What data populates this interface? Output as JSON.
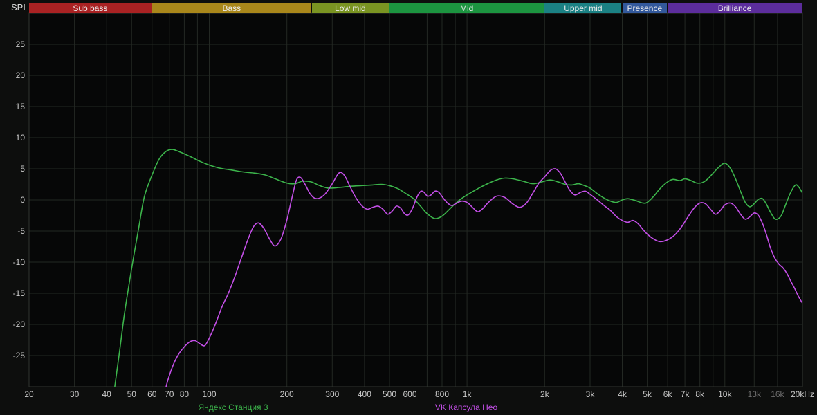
{
  "chart_data": {
    "type": "line",
    "title": "",
    "x_axis": {
      "scale": "log",
      "min": 20,
      "max": 20000,
      "unit": "Hz"
    },
    "y_axis": {
      "label": "SPL",
      "min": -30,
      "max": 30,
      "tick_step": 5
    },
    "y_ticks": [
      25,
      20,
      15,
      10,
      5,
      0,
      -5,
      -10,
      -15,
      -20,
      -25
    ],
    "x_ticks": [
      {
        "f": 20,
        "label": "20"
      },
      {
        "f": 30,
        "label": "30"
      },
      {
        "f": 40,
        "label": "40"
      },
      {
        "f": 50,
        "label": "50"
      },
      {
        "f": 60,
        "label": "60"
      },
      {
        "f": 70,
        "label": "70"
      },
      {
        "f": 80,
        "label": "80"
      },
      {
        "f": 100,
        "label": "100"
      },
      {
        "f": 200,
        "label": "200"
      },
      {
        "f": 300,
        "label": "300"
      },
      {
        "f": 400,
        "label": "400"
      },
      {
        "f": 500,
        "label": "500"
      },
      {
        "f": 600,
        "label": "600"
      },
      {
        "f": 800,
        "label": "800"
      },
      {
        "f": 1000,
        "label": "1k"
      },
      {
        "f": 2000,
        "label": "2k"
      },
      {
        "f": 3000,
        "label": "3k"
      },
      {
        "f": 4000,
        "label": "4k"
      },
      {
        "f": 5000,
        "label": "5k"
      },
      {
        "f": 6000,
        "label": "6k"
      },
      {
        "f": 7000,
        "label": "7k"
      },
      {
        "f": 8000,
        "label": "8k"
      },
      {
        "f": 10000,
        "label": "10k"
      },
      {
        "f": 13000,
        "label": "13k",
        "muted": true
      },
      {
        "f": 16000,
        "label": "16k",
        "muted": true
      },
      {
        "f": 20000,
        "label": "20kHz"
      }
    ],
    "grid_frequencies": [
      20,
      30,
      40,
      50,
      60,
      70,
      80,
      90,
      100,
      200,
      300,
      400,
      500,
      600,
      700,
      800,
      900,
      1000,
      2000,
      3000,
      4000,
      5000,
      6000,
      7000,
      8000,
      9000,
      10000,
      13000,
      16000,
      20000
    ],
    "bands": [
      {
        "label": "Sub bass",
        "from": 20,
        "to": 60,
        "color": "#a92223"
      },
      {
        "label": "Bass",
        "from": 60,
        "to": 250,
        "color": "#a9871b"
      },
      {
        "label": "Low mid",
        "from": 250,
        "to": 500,
        "color": "#7a9422"
      },
      {
        "label": "Mid",
        "from": 500,
        "to": 2000,
        "color": "#1c9440"
      },
      {
        "label": "Upper mid",
        "from": 2000,
        "to": 4000,
        "color": "#1b8184"
      },
      {
        "label": "Presence",
        "from": 4000,
        "to": 6000,
        "color": "#33599c"
      },
      {
        "label": "Brilliance",
        "from": 6000,
        "to": 20000,
        "color": "#5c2d9c"
      }
    ],
    "series": [
      {
        "name": "Яндекс Станция 3",
        "color": "#3cb44b",
        "points": [
          [
            43,
            -30
          ],
          [
            45,
            -24
          ],
          [
            47,
            -18
          ],
          [
            50,
            -11
          ],
          [
            53,
            -5
          ],
          [
            56,
            0.5
          ],
          [
            60,
            4
          ],
          [
            64,
            6.6
          ],
          [
            68,
            7.8
          ],
          [
            72,
            8.1
          ],
          [
            78,
            7.6
          ],
          [
            85,
            6.9
          ],
          [
            92,
            6.2
          ],
          [
            100,
            5.6
          ],
          [
            110,
            5.1
          ],
          [
            122,
            4.8
          ],
          [
            135,
            4.5
          ],
          [
            150,
            4.3
          ],
          [
            165,
            4.0
          ],
          [
            180,
            3.4
          ],
          [
            200,
            2.7
          ],
          [
            215,
            2.6
          ],
          [
            230,
            3.0
          ],
          [
            248,
            2.9
          ],
          [
            268,
            2.3
          ],
          [
            290,
            1.9
          ],
          [
            320,
            2.0
          ],
          [
            355,
            2.2
          ],
          [
            390,
            2.3
          ],
          [
            430,
            2.4
          ],
          [
            465,
            2.5
          ],
          [
            500,
            2.3
          ],
          [
            540,
            1.8
          ],
          [
            580,
            1.0
          ],
          [
            620,
            0.2
          ],
          [
            660,
            -1.0
          ],
          [
            700,
            -2.2
          ],
          [
            750,
            -3.0
          ],
          [
            800,
            -2.6
          ],
          [
            850,
            -1.6
          ],
          [
            900,
            -0.6
          ],
          [
            950,
            0.2
          ],
          [
            1000,
            0.8
          ],
          [
            1100,
            1.8
          ],
          [
            1200,
            2.6
          ],
          [
            1300,
            3.2
          ],
          [
            1400,
            3.5
          ],
          [
            1500,
            3.4
          ],
          [
            1650,
            3.0
          ],
          [
            1800,
            2.6
          ],
          [
            1950,
            2.9
          ],
          [
            2100,
            3.2
          ],
          [
            2250,
            2.9
          ],
          [
            2400,
            2.5
          ],
          [
            2550,
            2.4
          ],
          [
            2700,
            2.6
          ],
          [
            2850,
            2.3
          ],
          [
            3000,
            1.9
          ],
          [
            3200,
            1.0
          ],
          [
            3400,
            0.3
          ],
          [
            3600,
            -0.2
          ],
          [
            3800,
            -0.4
          ],
          [
            4000,
            0.0
          ],
          [
            4200,
            0.2
          ],
          [
            4500,
            -0.1
          ],
          [
            4800,
            -0.5
          ],
          [
            5000,
            -0.4
          ],
          [
            5300,
            0.6
          ],
          [
            5600,
            1.8
          ],
          [
            6000,
            2.9
          ],
          [
            6300,
            3.3
          ],
          [
            6700,
            3.1
          ],
          [
            7000,
            3.4
          ],
          [
            7400,
            3.1
          ],
          [
            7800,
            2.7
          ],
          [
            8200,
            2.8
          ],
          [
            8600,
            3.4
          ],
          [
            9000,
            4.3
          ],
          [
            9500,
            5.3
          ],
          [
            10000,
            5.9
          ],
          [
            10500,
            5.1
          ],
          [
            11000,
            3.4
          ],
          [
            11500,
            1.4
          ],
          [
            12000,
            -0.4
          ],
          [
            12500,
            -1.1
          ],
          [
            13000,
            -0.6
          ],
          [
            13500,
            0.1
          ],
          [
            14000,
            0.2
          ],
          [
            14500,
            -0.7
          ],
          [
            15000,
            -1.9
          ],
          [
            15700,
            -3.1
          ],
          [
            16500,
            -2.6
          ],
          [
            17200,
            -0.8
          ],
          [
            18000,
            1.2
          ],
          [
            18800,
            2.4
          ],
          [
            19400,
            2.0
          ],
          [
            20000,
            1.1
          ]
        ]
      },
      {
        "name": "VK Капсула Нео",
        "color": "#c44fe8",
        "points": [
          [
            68,
            -30
          ],
          [
            70,
            -28.2
          ],
          [
            73,
            -26.2
          ],
          [
            76,
            -24.8
          ],
          [
            80,
            -23.6
          ],
          [
            84,
            -22.8
          ],
          [
            88,
            -22.6
          ],
          [
            92,
            -23.1
          ],
          [
            96,
            -23.4
          ],
          [
            100,
            -22.2
          ],
          [
            106,
            -19.8
          ],
          [
            112,
            -17.2
          ],
          [
            118,
            -15.2
          ],
          [
            125,
            -12.6
          ],
          [
            132,
            -9.8
          ],
          [
            140,
            -6.8
          ],
          [
            148,
            -4.4
          ],
          [
            155,
            -3.7
          ],
          [
            163,
            -4.6
          ],
          [
            172,
            -6.4
          ],
          [
            180,
            -7.4
          ],
          [
            190,
            -6.2
          ],
          [
            200,
            -3.2
          ],
          [
            210,
            0.6
          ],
          [
            218,
            3.2
          ],
          [
            226,
            3.6
          ],
          [
            236,
            2.4
          ],
          [
            246,
            1.0
          ],
          [
            256,
            0.3
          ],
          [
            268,
            0.3
          ],
          [
            282,
            1.0
          ],
          [
            300,
            2.6
          ],
          [
            315,
            4.1
          ],
          [
            325,
            4.4
          ],
          [
            337,
            3.7
          ],
          [
            352,
            2.1
          ],
          [
            370,
            0.4
          ],
          [
            390,
            -0.9
          ],
          [
            410,
            -1.5
          ],
          [
            430,
            -1.2
          ],
          [
            452,
            -1.0
          ],
          [
            472,
            -1.5
          ],
          [
            492,
            -2.3
          ],
          [
            512,
            -1.8
          ],
          [
            532,
            -1.0
          ],
          [
            552,
            -1.3
          ],
          [
            572,
            -2.2
          ],
          [
            592,
            -2.4
          ],
          [
            615,
            -1.3
          ],
          [
            640,
            0.5
          ],
          [
            662,
            1.4
          ],
          [
            682,
            1.2
          ],
          [
            702,
            0.6
          ],
          [
            725,
            0.8
          ],
          [
            750,
            1.4
          ],
          [
            778,
            1.2
          ],
          [
            808,
            0.3
          ],
          [
            840,
            -0.5
          ],
          [
            872,
            -0.9
          ],
          [
            905,
            -0.6
          ],
          [
            950,
            -0.2
          ],
          [
            1000,
            -0.4
          ],
          [
            1050,
            -1.2
          ],
          [
            1100,
            -1.9
          ],
          [
            1150,
            -1.4
          ],
          [
            1210,
            -0.4
          ],
          [
            1300,
            0.6
          ],
          [
            1400,
            0.4
          ],
          [
            1500,
            -0.6
          ],
          [
            1600,
            -1.2
          ],
          [
            1700,
            -0.5
          ],
          [
            1800,
            1.1
          ],
          [
            1900,
            2.7
          ],
          [
            2000,
            3.7
          ],
          [
            2100,
            4.7
          ],
          [
            2200,
            5.0
          ],
          [
            2300,
            4.3
          ],
          [
            2400,
            2.9
          ],
          [
            2500,
            1.6
          ],
          [
            2620,
            0.8
          ],
          [
            2750,
            1.2
          ],
          [
            2880,
            1.4
          ],
          [
            3000,
            0.9
          ],
          [
            3200,
            0.0
          ],
          [
            3400,
            -0.9
          ],
          [
            3600,
            -1.7
          ],
          [
            3800,
            -2.7
          ],
          [
            4000,
            -3.3
          ],
          [
            4200,
            -3.6
          ],
          [
            4400,
            -3.3
          ],
          [
            4600,
            -3.8
          ],
          [
            4800,
            -4.7
          ],
          [
            5000,
            -5.5
          ],
          [
            5300,
            -6.3
          ],
          [
            5600,
            -6.7
          ],
          [
            6000,
            -6.4
          ],
          [
            6400,
            -5.6
          ],
          [
            6800,
            -4.3
          ],
          [
            7200,
            -2.7
          ],
          [
            7600,
            -1.3
          ],
          [
            8000,
            -0.5
          ],
          [
            8400,
            -0.6
          ],
          [
            8800,
            -1.5
          ],
          [
            9200,
            -2.3
          ],
          [
            9600,
            -1.7
          ],
          [
            10000,
            -0.8
          ],
          [
            10500,
            -0.5
          ],
          [
            11000,
            -1.1
          ],
          [
            11500,
            -2.3
          ],
          [
            12000,
            -3.1
          ],
          [
            12500,
            -2.7
          ],
          [
            13000,
            -2.1
          ],
          [
            13500,
            -2.5
          ],
          [
            14000,
            -3.8
          ],
          [
            14500,
            -5.6
          ],
          [
            15000,
            -7.6
          ],
          [
            15600,
            -9.3
          ],
          [
            16200,
            -10.3
          ],
          [
            16800,
            -10.9
          ],
          [
            17400,
            -11.8
          ],
          [
            18000,
            -13.0
          ],
          [
            18700,
            -14.3
          ],
          [
            19300,
            -15.5
          ],
          [
            20000,
            -16.6
          ]
        ]
      }
    ],
    "legend": {
      "position": "bottom"
    },
    "colors": {
      "page_background": "#0d0e0d",
      "plot_background": "#060707",
      "grid": "#232823",
      "plot_border": "#313631",
      "tick_text": "#c9c9c9",
      "muted_tick_text": "#6e6e6e",
      "spl_text": "#dcdcdc"
    }
  }
}
